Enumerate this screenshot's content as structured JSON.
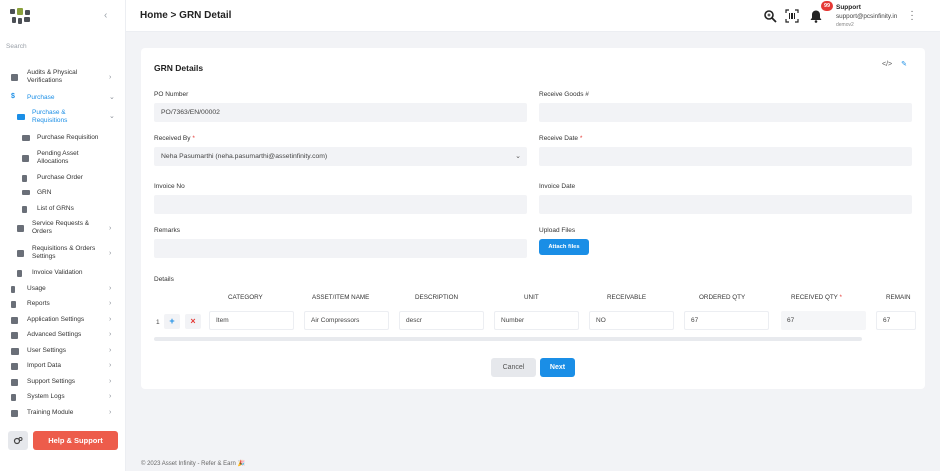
{
  "sidebar": {
    "search_placeholder": "Search",
    "items": [
      {
        "label": "Audits & Physical Verifications",
        "icon": "audit-icon"
      },
      {
        "label": "Purchase",
        "icon": "dollar-icon"
      },
      {
        "label": "Purchase & Requisitions",
        "icon": "cart-icon"
      },
      {
        "label": "Purchase Requisition",
        "icon": "laptop-icon"
      },
      {
        "label": "Pending Asset Allocations",
        "icon": "hierarchy-icon"
      },
      {
        "label": "Purchase Order",
        "icon": "document-icon"
      },
      {
        "label": "GRN",
        "icon": "receipt-icon"
      },
      {
        "label": "List of GRNs",
        "icon": "list-icon"
      },
      {
        "label": "Service Requests & Orders",
        "icon": "service-icon"
      },
      {
        "label": "Requisitions & Orders Settings",
        "icon": "cart-settings-icon"
      },
      {
        "label": "Invoice Validation",
        "icon": "invoice-icon"
      },
      {
        "label": "Usage",
        "icon": "flash-icon"
      },
      {
        "label": "Reports",
        "icon": "report-icon"
      },
      {
        "label": "Application Settings",
        "icon": "wrench-icon"
      },
      {
        "label": "Advanced Settings",
        "icon": "gears-icon"
      },
      {
        "label": "User Settings",
        "icon": "users-icon"
      },
      {
        "label": "Import Data",
        "icon": "import-icon"
      },
      {
        "label": "Support Settings",
        "icon": "support-gear-icon"
      },
      {
        "label": "System Logs",
        "icon": "log-icon"
      },
      {
        "label": "Training Module",
        "icon": "training-icon"
      }
    ],
    "help_label": "Help & Support"
  },
  "header": {
    "breadcrumb": "Home > GRN Detail",
    "notification_count": "99",
    "user_name": "Support",
    "user_email": "support@pcsinfinity.in",
    "user_tenant": "demov2"
  },
  "card": {
    "title": "GRN Details",
    "fields": {
      "po_number_label": "PO Number",
      "po_number_value": "PO/7363/EN/00002",
      "receive_goods_label": "Receive Goods #",
      "received_by_label": "Received By",
      "received_by_value": "Neha Pasumarthi (neha.pasumarthi@assetinfinity.com)",
      "receive_date_label": "Receive Date",
      "invoice_no_label": "Invoice No",
      "invoice_date_label": "Invoice Date",
      "remarks_label": "Remarks",
      "upload_files_label": "Upload Files",
      "attach_files_label": "Attach files",
      "required_mark": "*"
    },
    "details_label": "Details",
    "table": {
      "headers": [
        "CATEGORY",
        "ASSET/ITEM NAME",
        "DESCRIPTION",
        "UNIT",
        "RECEIVABLE",
        "ORDERED QTY",
        "RECEIVED QTY",
        "REMAIN"
      ],
      "row": {
        "number": "1",
        "add_symbol": "+",
        "remove_symbol": "×",
        "category": "Item",
        "asset_name": "Air Compressors",
        "description": "descr",
        "unit": "Number",
        "receivable": "NO",
        "ordered_qty": "67",
        "received_qty": "67",
        "remaining": "67"
      }
    },
    "cancel_label": "Cancel",
    "next_label": "Next"
  },
  "footer": "© 2023 Asset Infinity - Refer & Earn 🎉",
  "colors": {
    "accent": "#1a8ee6",
    "help": "#ed5c4b",
    "badge": "#e53935"
  }
}
